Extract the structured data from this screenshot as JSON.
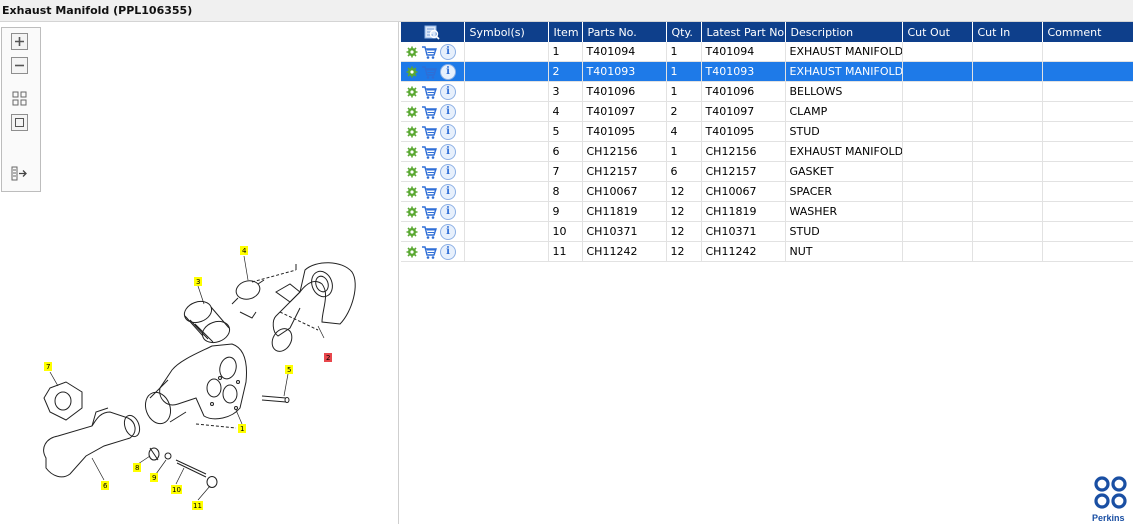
{
  "window": {
    "title": "Exhaust Manifold (PPL106355)"
  },
  "toolbar": {
    "buttons": [
      "zoom-in",
      "zoom-out",
      "fit-all",
      "actual-size",
      "export"
    ]
  },
  "table": {
    "columns": [
      "",
      "Symbol(s)",
      "Item",
      "Parts No.",
      "Qty.",
      "Latest Part No.",
      "Description",
      "Cut Out",
      "Cut In",
      "Comment"
    ],
    "selected_row": 1,
    "rows": [
      {
        "symbols": "",
        "item": "1",
        "part_no": "T401094",
        "qty": "1",
        "latest": "T401094",
        "description": "EXHAUST MANIFOLD",
        "cut_out": "",
        "cut_in": "",
        "comment": ""
      },
      {
        "symbols": "",
        "item": "2",
        "part_no": "T401093",
        "qty": "1",
        "latest": "T401093",
        "description": "EXHAUST MANIFOLD",
        "cut_out": "",
        "cut_in": "",
        "comment": ""
      },
      {
        "symbols": "",
        "item": "3",
        "part_no": "T401096",
        "qty": "1",
        "latest": "T401096",
        "description": "BELLOWS",
        "cut_out": "",
        "cut_in": "",
        "comment": ""
      },
      {
        "symbols": "",
        "item": "4",
        "part_no": "T401097",
        "qty": "2",
        "latest": "T401097",
        "description": "CLAMP",
        "cut_out": "",
        "cut_in": "",
        "comment": ""
      },
      {
        "symbols": "",
        "item": "5",
        "part_no": "T401095",
        "qty": "4",
        "latest": "T401095",
        "description": "STUD",
        "cut_out": "",
        "cut_in": "",
        "comment": ""
      },
      {
        "symbols": "",
        "item": "6",
        "part_no": "CH12156",
        "qty": "1",
        "latest": "CH12156",
        "description": "EXHAUST MANIFOLD",
        "cut_out": "",
        "cut_in": "",
        "comment": ""
      },
      {
        "symbols": "",
        "item": "7",
        "part_no": "CH12157",
        "qty": "6",
        "latest": "CH12157",
        "description": "GASKET",
        "cut_out": "",
        "cut_in": "",
        "comment": ""
      },
      {
        "symbols": "",
        "item": "8",
        "part_no": "CH10067",
        "qty": "12",
        "latest": "CH10067",
        "description": "SPACER",
        "cut_out": "",
        "cut_in": "",
        "comment": ""
      },
      {
        "symbols": "",
        "item": "9",
        "part_no": "CH11819",
        "qty": "12",
        "latest": "CH11819",
        "description": "WASHER",
        "cut_out": "",
        "cut_in": "",
        "comment": ""
      },
      {
        "symbols": "",
        "item": "10",
        "part_no": "CH10371",
        "qty": "12",
        "latest": "CH10371",
        "description": "STUD",
        "cut_out": "",
        "cut_in": "",
        "comment": ""
      },
      {
        "symbols": "",
        "item": "11",
        "part_no": "CH11242",
        "qty": "12",
        "latest": "CH11242",
        "description": "NUT",
        "cut_out": "",
        "cut_in": "",
        "comment": ""
      }
    ]
  },
  "diagram": {
    "callouts": [
      "1",
      "2",
      "3",
      "4",
      "5",
      "6",
      "7",
      "8",
      "9",
      "10",
      "11"
    ],
    "highlighted_callout": "2",
    "callout_color": "#ffff00",
    "highlight_color": "#e8474c"
  },
  "logo": {
    "text": "Perkins"
  },
  "colors": {
    "header": "#0e3f8b",
    "selected_row": "#1e7ae8",
    "gear": "#5aa832",
    "cart": "#2f6ed6"
  }
}
